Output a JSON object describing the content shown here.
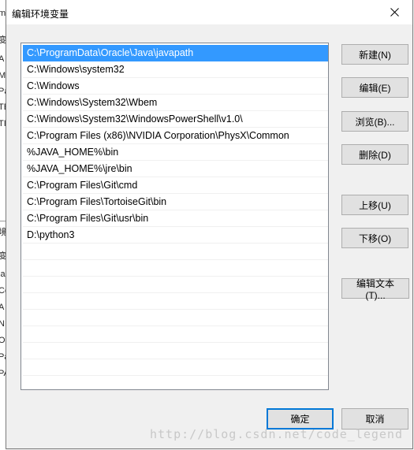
{
  "background_window": {
    "fragments": [
      "m",
      "变",
      "A",
      "M",
      "Pa",
      "TE",
      "TI",
      "境",
      "变",
      "la",
      "Co",
      "A",
      "N",
      "O",
      "Pa",
      "PA"
    ]
  },
  "dialog": {
    "title": "编辑环境变量",
    "close_glyph": "close-icon"
  },
  "paths": [
    "C:\\ProgramData\\Oracle\\Java\\javapath",
    "C:\\Windows\\system32",
    "C:\\Windows",
    "C:\\Windows\\System32\\Wbem",
    "C:\\Windows\\System32\\WindowsPowerShell\\v1.0\\",
    "C:\\Program Files (x86)\\NVIDIA Corporation\\PhysX\\Common",
    "%JAVA_HOME%\\bin",
    "%JAVA_HOME%\\jre\\bin",
    "C:\\Program Files\\Git\\cmd",
    "C:\\Program Files\\TortoiseGit\\bin",
    "C:\\Program Files\\Git\\usr\\bin",
    "D:\\python3"
  ],
  "selected_index": 0,
  "buttons": {
    "new": "新建(N)",
    "edit": "编辑(E)",
    "browse": "浏览(B)...",
    "delete": "删除(D)",
    "move_up": "上移(U)",
    "move_down": "下移(O)",
    "edit_text": "编辑文本(T)...",
    "ok": "确定",
    "cancel": "取消"
  },
  "watermark": "http://blog.csdn.net/code_legend"
}
